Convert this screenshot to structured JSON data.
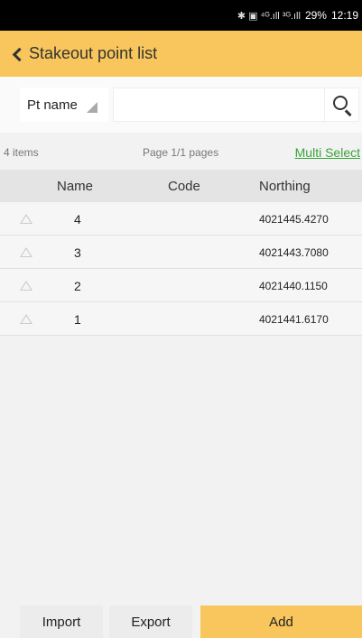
{
  "status_bar": {
    "icons": "✱ ▣ ⁴ᴳ.ıll ³ᴳ.ıll",
    "battery": "29%",
    "time": "12:19"
  },
  "header": {
    "title": "Stakeout point list",
    "back_icon": "back-chevron-icon"
  },
  "search": {
    "field_label": "Pt name",
    "value": "",
    "placeholder": ""
  },
  "info": {
    "count_text": "4 items",
    "page_text": "Page 1/1 pages",
    "multi_select_label": "Multi Select"
  },
  "table": {
    "columns": [
      "Name",
      "Code",
      "Northing"
    ],
    "rows": [
      {
        "name": "4",
        "code": "",
        "northing": "4021445.4270"
      },
      {
        "name": "3",
        "code": "",
        "northing": "4021443.7080"
      },
      {
        "name": "2",
        "code": "",
        "northing": "4021440.1150"
      },
      {
        "name": "1",
        "code": "",
        "northing": "4021441.6170"
      }
    ]
  },
  "actions": {
    "import_label": "Import",
    "export_label": "Export",
    "add_label": "Add"
  },
  "colors": {
    "accent": "#f8c65c",
    "link": "#3aa33a"
  }
}
